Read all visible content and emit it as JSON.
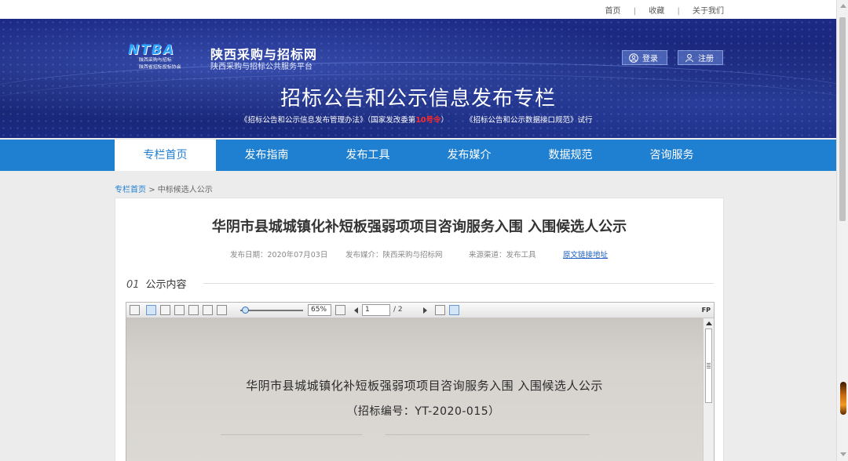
{
  "topbar": {
    "links": [
      "首页",
      "收藏",
      "关于我们"
    ],
    "separator": "|"
  },
  "header": {
    "logo_mark": "NTBA",
    "logo_sub1": "陕西采购与招标",
    "logo_sub2": "陕西省招标投标协会",
    "site_name": "陕西采购与招标网",
    "site_sub": "陕西采购与招标公共服务平台",
    "login_label": "登录",
    "register_label": "注册",
    "banner_title": "招标公告和公示信息发布专栏",
    "note_part1": "《招标公告和公示信息发布管理办法》（国家发改委第",
    "note_red": "10号令",
    "note_part2": "）",
    "note_part3": "《招标公告和公示数据接口规范》试行"
  },
  "nav": {
    "items": [
      "专栏首页",
      "发布指南",
      "发布工具",
      "发布媒介",
      "数据规范",
      "咨询服务"
    ],
    "active_index": 0
  },
  "breadcrumb": {
    "home": "专栏首页",
    "sep": ">",
    "current": "中标候选人公示"
  },
  "article": {
    "title": "华阴市县城城镇化补短板强弱项项目咨询服务入围 入围候选人公示",
    "publish_date": "发布日期：2020年07月03日",
    "publish_media": "发布媒介：陕西采购与招标网",
    "source": "来源渠道：发布工具",
    "original_link": "原文链接地址",
    "section_num": "01",
    "section_title": "公示内容"
  },
  "viewer": {
    "zoom": "65%",
    "page_current": "1",
    "page_total": "/ 2",
    "fp_label": "FP",
    "doc_title": "华阴市县城城镇化补短板强弱项项目咨询服务入围   入围候选人公示",
    "doc_code": "（招标编号：YT-2020-015）"
  },
  "colors": {
    "nav_blue": "#1f7fd0",
    "header_navy": "#1c2a86",
    "note_red": "#ff2a2a"
  }
}
